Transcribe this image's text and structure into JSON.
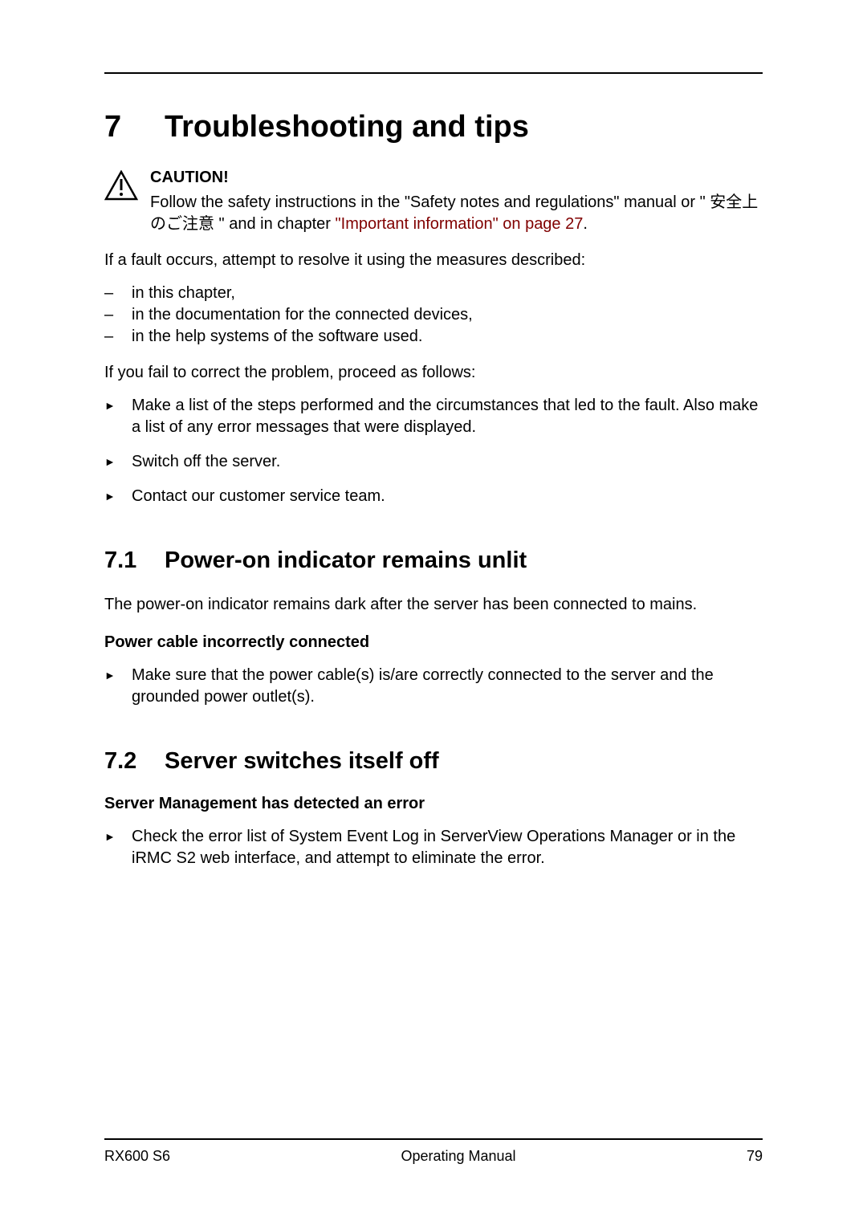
{
  "chapter": {
    "number": "7",
    "title": "Troubleshooting and tips"
  },
  "caution": {
    "label": "CAUTION!",
    "text_before": "Follow the safety instructions in the \"Safety notes and regulations\" manual or \" 安全上のご注意 \" and in chapter ",
    "link": "\"Important information\" on page 27",
    "text_after": "."
  },
  "intro1": "If a fault occurs, attempt to resolve it using the measures described:",
  "dash_items": [
    "in this chapter,",
    "in the documentation for the connected devices,",
    "in the help systems of the software used."
  ],
  "intro2": "If you fail to correct the problem, proceed as follows:",
  "arrow_items1": [
    "Make a list of the steps performed and the circumstances that led to the fault. Also make a list of any error messages that were displayed.",
    "Switch off the server.",
    "Contact our customer service team."
  ],
  "section71": {
    "number": "7.1",
    "title": "Power-on indicator remains unlit",
    "body": "The power-on indicator remains dark after the server has been connected to mains.",
    "subhead": "Power cable incorrectly connected",
    "arrow_items": [
      "Make sure that the power cable(s) is/are correctly connected to the server and the grounded power outlet(s)."
    ]
  },
  "section72": {
    "number": "7.2",
    "title": "Server switches itself off",
    "subhead": "Server Management has detected an error",
    "arrow_items": [
      "Check the error list of System Event Log in ServerView Operations Manager or in the iRMC S2 web interface, and attempt to eliminate the error."
    ]
  },
  "footer": {
    "left": "RX600 S6",
    "center": "Operating Manual",
    "right": "79"
  }
}
